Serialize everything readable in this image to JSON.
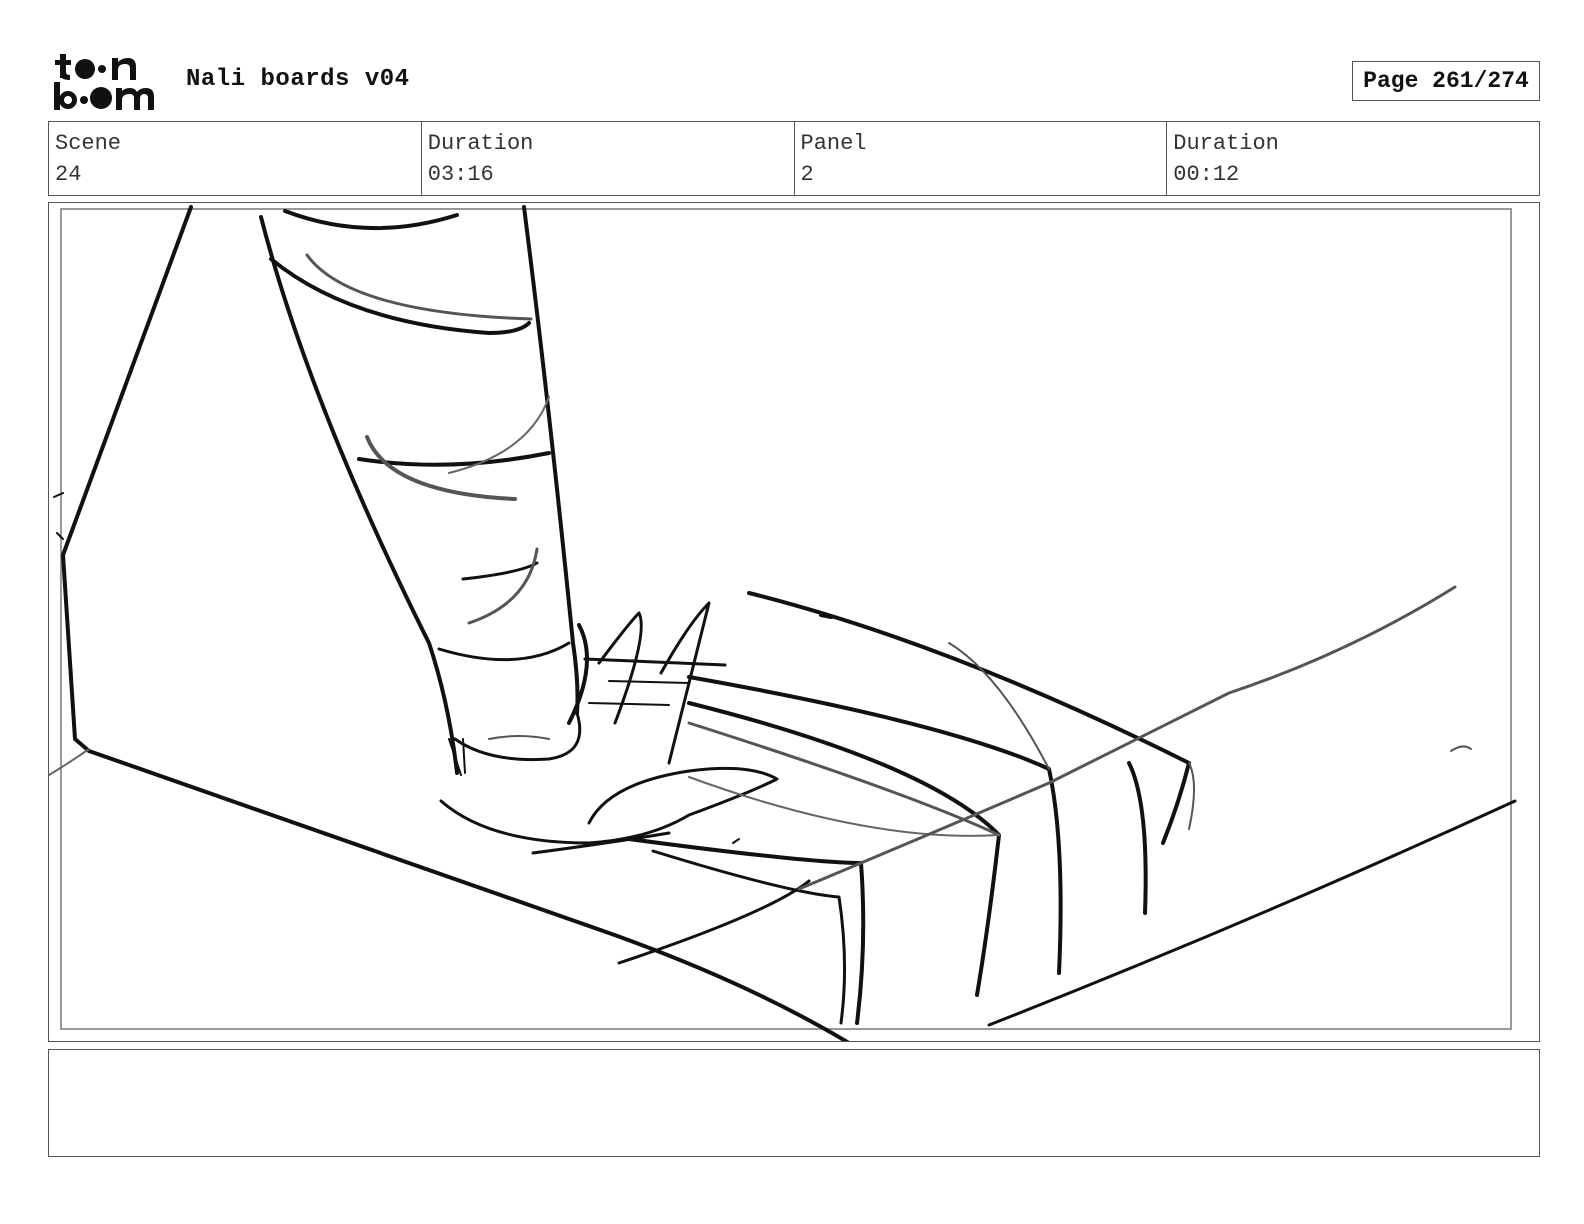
{
  "header": {
    "logo_text": "toonboom",
    "title": "Nali boards v04",
    "page": "Page 261/274"
  },
  "info": {
    "scene_label": "Scene",
    "scene_value": "24",
    "scene_duration_label": "Duration",
    "scene_duration_value": "03:16",
    "panel_label": "Panel",
    "panel_value": "2",
    "panel_duration_label": "Duration",
    "panel_duration_value": "00:12"
  },
  "notes": {
    "text": ""
  }
}
